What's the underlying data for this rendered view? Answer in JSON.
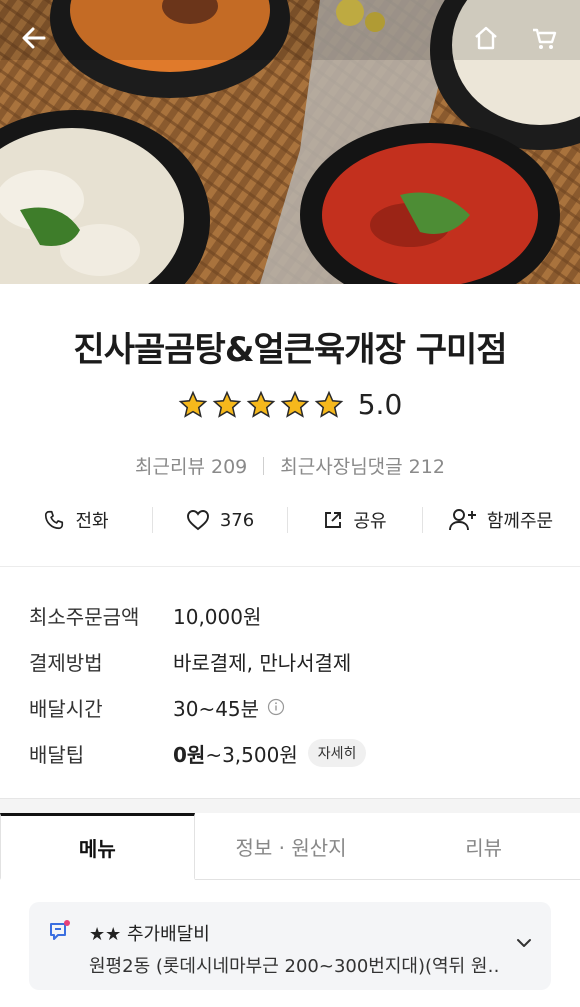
{
  "store": {
    "name": "진사골곰탕&얼큰육개장 구미점",
    "rating": "5.0",
    "stars_filled": 5,
    "stars_total": 5,
    "recent_reviews": "최근리뷰 209",
    "recent_owner_replies": "최근사장님댓글 212"
  },
  "actions": {
    "call_label": "전화",
    "like_count": "376",
    "share_label": "공유",
    "group_order_label": "함께주문"
  },
  "info": {
    "min_order_label": "최소주문금액",
    "min_order_value": "10,000원",
    "payment_label": "결제방법",
    "payment_value": "바로결제, 만나서결제",
    "delivery_time_label": "배달시간",
    "delivery_time_value": "30~45분",
    "delivery_tip_label": "배달팁",
    "delivery_tip_min": "0원",
    "delivery_tip_max": "~3,500원",
    "detail_button": "자세히"
  },
  "tabs": [
    {
      "label": "메뉴",
      "active": true
    },
    {
      "label": "정보 · 원산지",
      "active": false
    },
    {
      "label": "리뷰",
      "active": false
    }
  ],
  "notice": {
    "title": "★★ 추가배달비",
    "body": "원평2동 (롯데시네마부근 200~300번지대)(역뒤 원…"
  },
  "colors": {
    "star": "#F5B81C",
    "tab_active": "#111111",
    "notice_bg": "#F4F5F7",
    "notice_dot": "#E8407A",
    "notice_icon": "#3B6FE0"
  },
  "icons": {
    "back": "arrow-left-icon",
    "home": "home-icon",
    "cart": "cart-icon",
    "phone": "phone-icon",
    "heart": "heart-icon",
    "share": "share-icon",
    "group": "person-add-icon",
    "info": "info-circle-icon",
    "notice": "speech-bubble-icon",
    "chevron": "chevron-down-icon"
  }
}
